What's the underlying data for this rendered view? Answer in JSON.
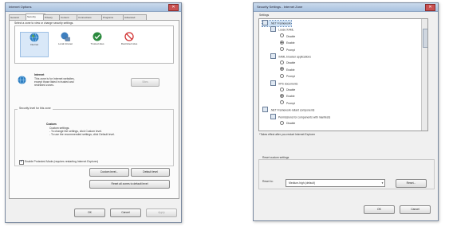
{
  "left_dialog": {
    "title": "Internet Options",
    "tabs": [
      "General",
      "Security",
      "Privacy",
      "Content",
      "Connections",
      "Programs",
      "Advanced"
    ],
    "zone_prompt": "Select a zone to view or change security settings.",
    "zones": [
      {
        "label": "Internet",
        "icon": "globe-icon"
      },
      {
        "label": "Local intranet",
        "icon": "intranet-icon"
      },
      {
        "label": "Trusted sites",
        "icon": "trusted-sites-icon"
      },
      {
        "label": "Restricted sites",
        "icon": "restricted-sites-icon"
      }
    ],
    "zone_title": "Internet",
    "zone_desc": [
      "This zone is for Internet websites,",
      "except those listed in trusted and",
      "restricted zones."
    ],
    "sites_button": "Sites",
    "level_group_label": "Security level for this zone",
    "custom_title": "Custom",
    "custom_lines": [
      "Custom settings.",
      "- To change the settings, click Custom level.",
      "- To use the recommended settings, click Default level."
    ],
    "protected_mode": "Enable Protected Mode (requires restarting Internet Explorer)",
    "custom_level_button": "Custom level...",
    "default_level_button": "Default level",
    "reset_all_button": "Reset all zones to default level",
    "ok_button": "OK",
    "cancel_button": "Cancel",
    "apply_button": "Apply"
  },
  "right_dialog": {
    "title": "Security Settings - Internet Zone",
    "settings_label": "Settings",
    "tree": [
      {
        "type": "cat",
        "label": ".NET Framework"
      },
      {
        "type": "sub",
        "label": "Loose XAML"
      },
      {
        "type": "opt",
        "label": "Disable",
        "on": false
      },
      {
        "type": "opt",
        "label": "Enable",
        "on": true
      },
      {
        "type": "opt",
        "label": "Prompt",
        "on": false
      },
      {
        "type": "sub",
        "label": "XAML browser applications"
      },
      {
        "type": "opt",
        "label": "Disable",
        "on": false
      },
      {
        "type": "opt",
        "label": "Enable",
        "on": true
      },
      {
        "type": "opt",
        "label": "Prompt",
        "on": false
      },
      {
        "type": "sub",
        "label": "XPS documents"
      },
      {
        "type": "opt",
        "label": "Disable",
        "on": false
      },
      {
        "type": "opt",
        "label": "Enable",
        "on": true
      },
      {
        "type": "opt",
        "label": "Prompt",
        "on": false
      },
      {
        "type": "cat",
        "label": ".NET Framework-reliant components"
      },
      {
        "type": "sub",
        "label": "Permissions for components with manifests"
      },
      {
        "type": "opt",
        "label": "Disable",
        "on": false
      }
    ],
    "restart_note": "*Takes effect after you restart Internet Explorer",
    "reset_group_label": "Reset custom settings",
    "reset_to_label": "Reset to:",
    "reset_to_value": "Medium-high (default)",
    "reset_button": "Reset...",
    "ok_button": "OK",
    "cancel_button": "Cancel"
  }
}
